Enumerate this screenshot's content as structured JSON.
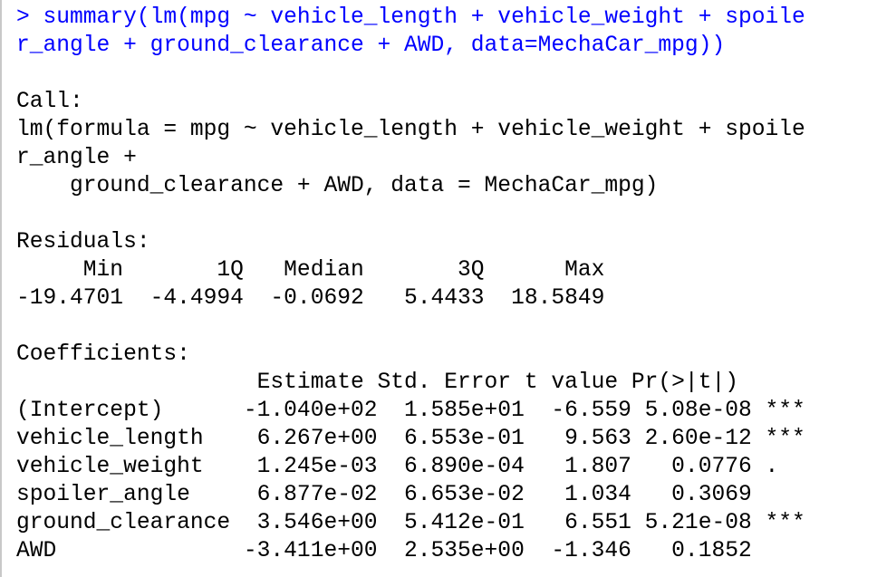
{
  "console": {
    "command": {
      "line1": "> summary(lm(mpg ~ vehicle_length + vehicle_weight + spoile",
      "line2": "r_angle + ground_clearance + AWD, data=MechaCar_mpg))"
    },
    "call": {
      "header": "Call:",
      "line1": "lm(formula = mpg ~ vehicle_length + vehicle_weight + spoile",
      "line2": "r_angle +",
      "line3": "    ground_clearance + AWD, data = MechaCar_mpg)"
    },
    "residuals": {
      "header": "Residuals:",
      "labels": "     Min       1Q   Median       3Q      Max ",
      "values": "-19.4701  -4.4994  -0.0692   5.4433  18.5849 "
    },
    "coefficients": {
      "header": "Coefficients:",
      "column_header": "                  Estimate Std. Error t value Pr(>|t|)    ",
      "rows": [
        "(Intercept)      -1.040e+02  1.585e+01  -6.559 5.08e-08 ***",
        "vehicle_length    6.267e+00  6.553e-01   9.563 2.60e-12 ***",
        "vehicle_weight    1.245e-03  6.890e-04   1.807   0.0776 .  ",
        "spoiler_angle     6.877e-02  6.653e-02   1.034   0.3069    ",
        "ground_clearance  3.546e+00  5.412e-01   6.551 5.21e-08 ***",
        "AWD              -3.411e+00  2.535e+00  -1.346   0.1852    "
      ]
    }
  },
  "colors": {
    "command": "#0000ff",
    "output": "#000000",
    "background": "#ffffff"
  }
}
